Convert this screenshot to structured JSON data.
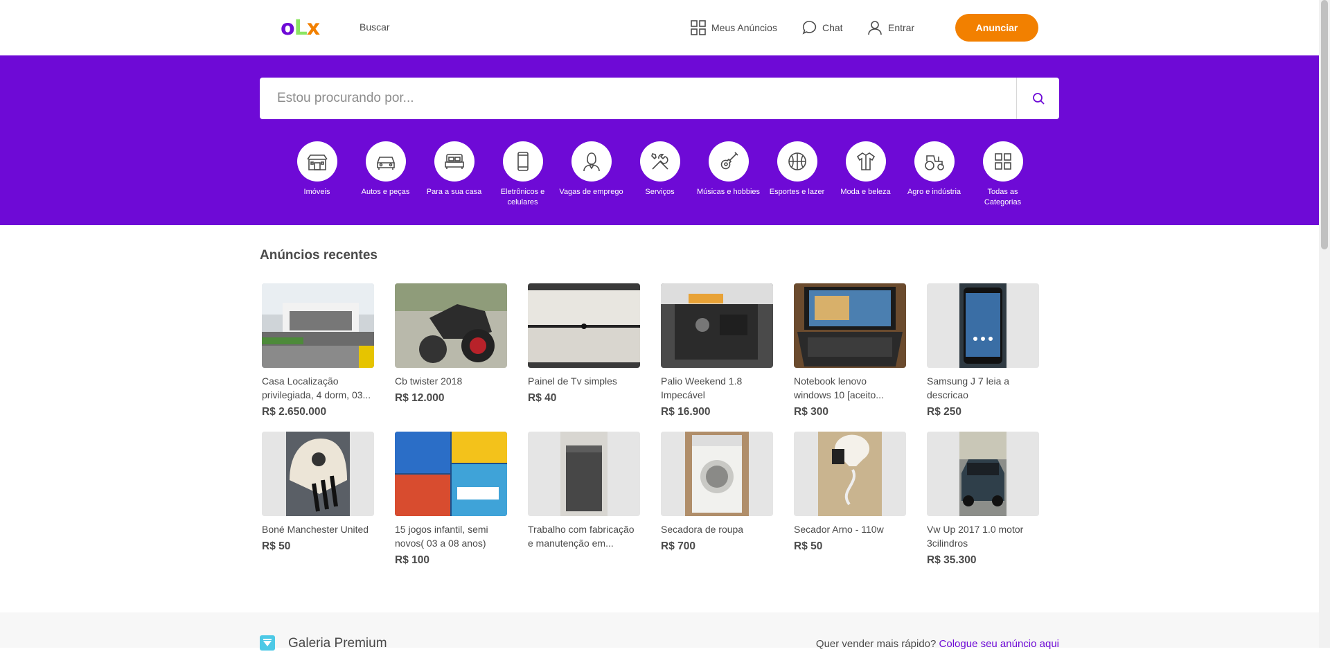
{
  "header": {
    "search_link": "Buscar",
    "my_ads": "Meus Anúncios",
    "chat": "Chat",
    "login": "Entrar",
    "post_ad": "Anunciar"
  },
  "search": {
    "placeholder": "Estou procurando por..."
  },
  "categories": [
    {
      "label": "Imóveis",
      "icon": "house-icon"
    },
    {
      "label": "Autos e peças",
      "icon": "car-icon"
    },
    {
      "label": "Para a sua casa",
      "icon": "bed-icon"
    },
    {
      "label": "Eletrônicos e celulares",
      "icon": "phone-icon"
    },
    {
      "label": "Vagas de emprego",
      "icon": "person-icon"
    },
    {
      "label": "Serviços",
      "icon": "tools-icon"
    },
    {
      "label": "Músicas e hobbies",
      "icon": "guitar-icon"
    },
    {
      "label": "Esportes e lazer",
      "icon": "ball-icon"
    },
    {
      "label": "Moda e beleza",
      "icon": "shirt-icon"
    },
    {
      "label": "Agro e indústria",
      "icon": "tractor-icon"
    },
    {
      "label": "Todas as Categorias",
      "icon": "grid-icon"
    }
  ],
  "recent": {
    "title": "Anúncios recentes",
    "items": [
      {
        "title": "Casa Localização privilegiada, 4 dorm, 03...",
        "price": "R$ 2.650.000"
      },
      {
        "title": "Cb twister 2018",
        "price": "R$ 12.000"
      },
      {
        "title": "Painel de Tv simples",
        "price": "R$ 40"
      },
      {
        "title": "Palio Weekend 1.8 Impecável",
        "price": "R$ 16.900"
      },
      {
        "title": "Notebook lenovo windows 10 [aceito...",
        "price": "R$ 300"
      },
      {
        "title": "Samsung J 7 leia a descricao",
        "price": "R$ 250"
      },
      {
        "title": "Boné Manchester United",
        "price": "R$ 50"
      },
      {
        "title": "15 jogos infantil, semi novos( 03 a 08 anos)",
        "price": "R$ 100"
      },
      {
        "title": "Trabalho com fabricação e manutenção em...",
        "price": ""
      },
      {
        "title": "Secadora de roupa",
        "price": "R$ 700"
      },
      {
        "title": "Secador Arno - 110w",
        "price": "R$ 50"
      },
      {
        "title": "Vw Up 2017 1.0 motor 3cilindros",
        "price": "R$ 35.300"
      }
    ]
  },
  "premium": {
    "title": "Galeria Premium",
    "question": "Quer vender mais rápido?",
    "link": "Cologue seu anúncio aqui"
  },
  "colors": {
    "brand_purple": "#6e0ad6",
    "brand_orange": "#f28000",
    "brand_green": "#8ce563"
  }
}
